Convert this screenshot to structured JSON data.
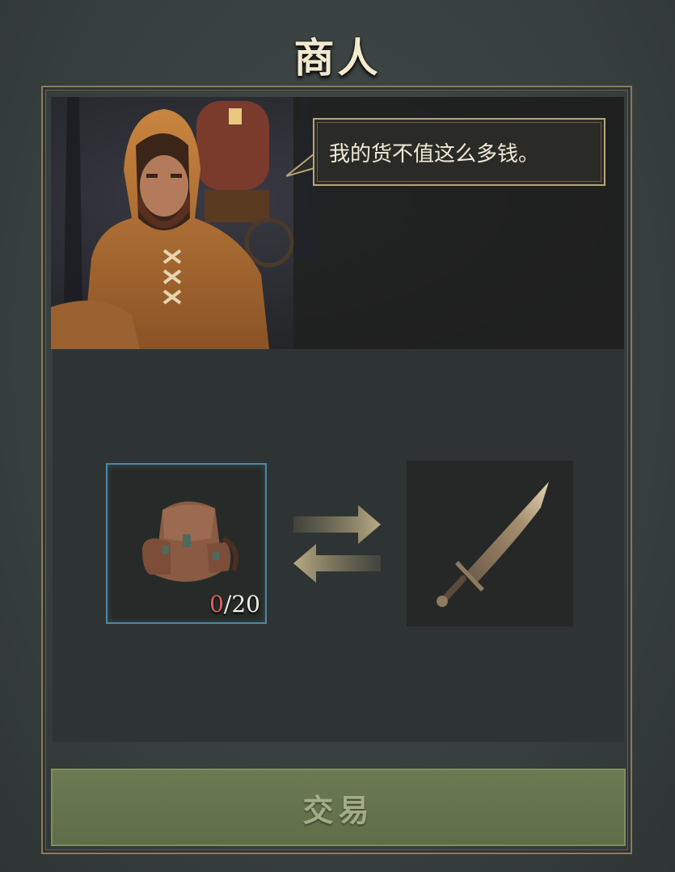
{
  "header": {
    "title": "商人"
  },
  "merchant": {
    "speech": "我的货不值这么多钱。"
  },
  "trade": {
    "offer_item": {
      "icon": "backpack-icon",
      "count_current": "0",
      "count_separator": "/",
      "count_max": "20"
    },
    "receive_item": {
      "icon": "sword-icon"
    },
    "swap_icon": "swap-arrows-icon"
  },
  "actions": {
    "trade_label": "交易"
  },
  "colors": {
    "accent_gold": "#b8a57a",
    "slot_selected_border": "#4e86a3",
    "count_warning": "#e06060",
    "button_green": "#6c7a52"
  }
}
